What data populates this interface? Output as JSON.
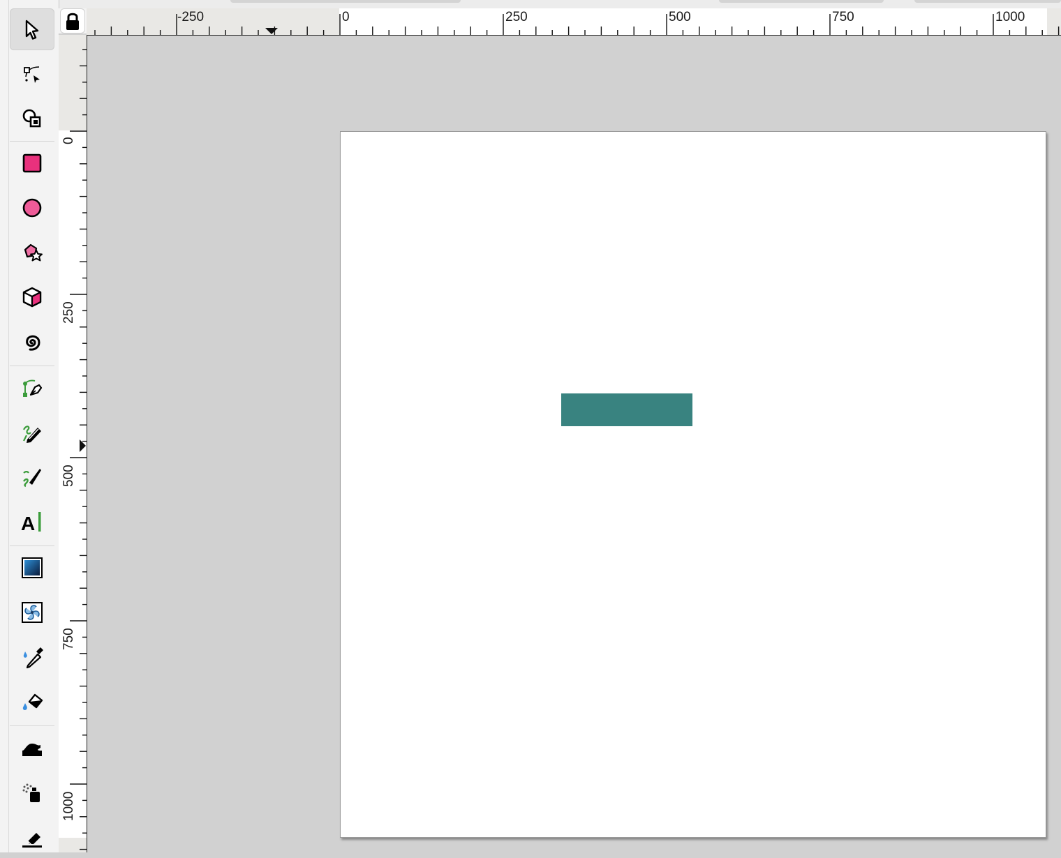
{
  "app": {
    "toolbox": {
      "tools": [
        {
          "id": "selector",
          "icon": "selector-arrow-icon",
          "active": true
        },
        {
          "id": "node",
          "icon": "node-tool-icon"
        },
        {
          "id": "shape-builder",
          "icon": "shape-builder-icon"
        },
        {
          "id": "rectangle",
          "icon": "rectangle-tool-icon"
        },
        {
          "id": "ellipse",
          "icon": "ellipse-tool-icon"
        },
        {
          "id": "star",
          "icon": "star-polygon-tool-icon"
        },
        {
          "id": "box3d",
          "icon": "3d-box-tool-icon"
        },
        {
          "id": "spiral",
          "icon": "spiral-tool-icon"
        },
        {
          "id": "pen",
          "icon": "pen-bezier-tool-icon"
        },
        {
          "id": "pencil",
          "icon": "pencil-tool-icon"
        },
        {
          "id": "calligraphy",
          "icon": "calligraphy-tool-icon"
        },
        {
          "id": "text",
          "icon": "text-tool-icon"
        },
        {
          "id": "gradient",
          "icon": "gradient-tool-icon"
        },
        {
          "id": "mesh",
          "icon": "mesh-tool-icon"
        },
        {
          "id": "dropper",
          "icon": "dropper-tool-icon"
        },
        {
          "id": "paint-bucket",
          "icon": "paint-bucket-tool-icon"
        },
        {
          "id": "tweak",
          "icon": "tweak-tool-icon"
        },
        {
          "id": "spray",
          "icon": "spray-tool-icon"
        },
        {
          "id": "eraser",
          "icon": "eraser-tool-icon"
        }
      ]
    },
    "rulers": {
      "lock_icon": "lock-icon",
      "horizontal_labels": [
        "-250",
        "0",
        "250",
        "500",
        "750",
        "1000"
      ],
      "vertical_labels": [
        "0",
        "250",
        "500",
        "750",
        "1000"
      ]
    },
    "canvas": {
      "background": "#d1d1d1",
      "page_color": "#ffffff",
      "shape_fill": "#398380"
    }
  }
}
